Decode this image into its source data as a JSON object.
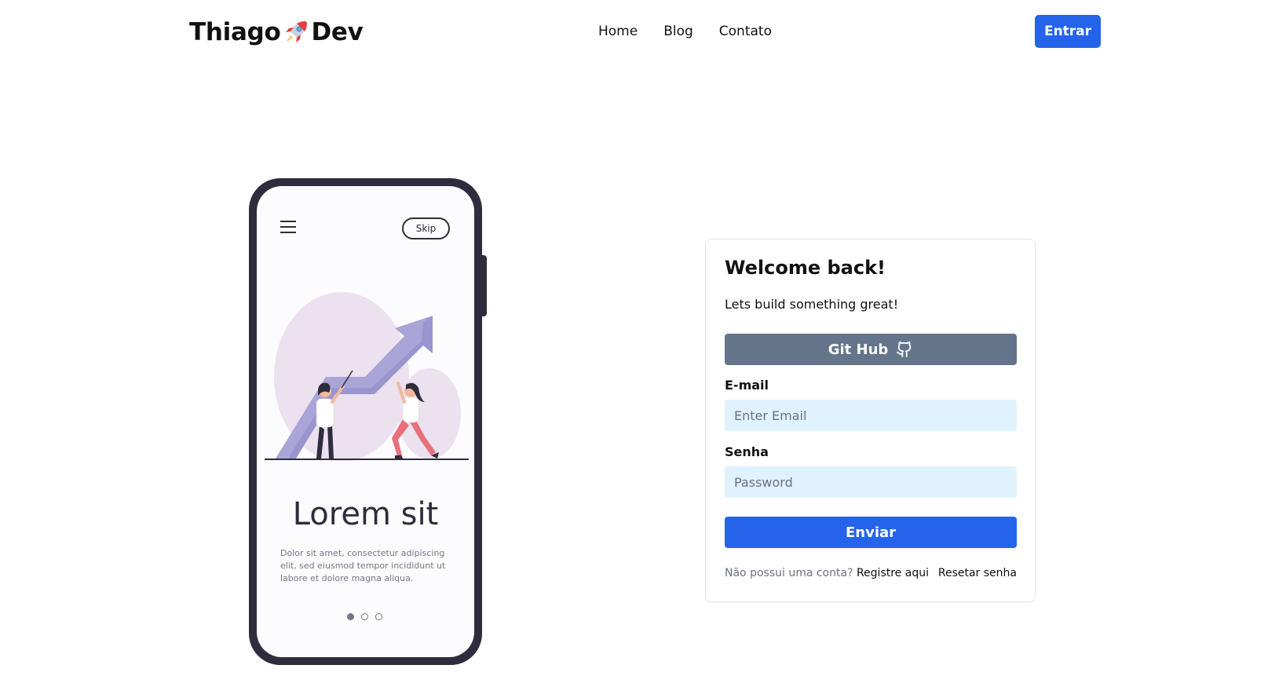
{
  "header": {
    "logo_left": "Thiago",
    "logo_right": "Dev",
    "logo_icon": "rocket-icon",
    "nav": [
      {
        "label": "Home"
      },
      {
        "label": "Blog"
      },
      {
        "label": "Contato"
      }
    ],
    "login_label": "Entrar"
  },
  "phone": {
    "skip_label": "Skip",
    "title": "Lorem sit",
    "text": "Dolor sit amet, consectetur adipiscing elit, sed eiusmod tempor incididunt ut labore et dolore magna aliqua.",
    "dots_total": 3,
    "dots_active": 1
  },
  "login": {
    "title": "Welcome back!",
    "subtitle": "Lets build something great!",
    "github_label": "Git Hub",
    "email_label": "E-mail",
    "email_placeholder": "Enter Email",
    "password_label": "Senha",
    "password_placeholder": "Password",
    "submit_label": "Enviar",
    "no_account_text": "Não possui uma conta?",
    "register_link": "Registre aqui",
    "reset_link": "Resetar senha"
  },
  "colors": {
    "primary": "#2563eb",
    "github": "#64748b",
    "input_bg": "#e0f2fe",
    "phone_frame": "#2f2c3d"
  }
}
